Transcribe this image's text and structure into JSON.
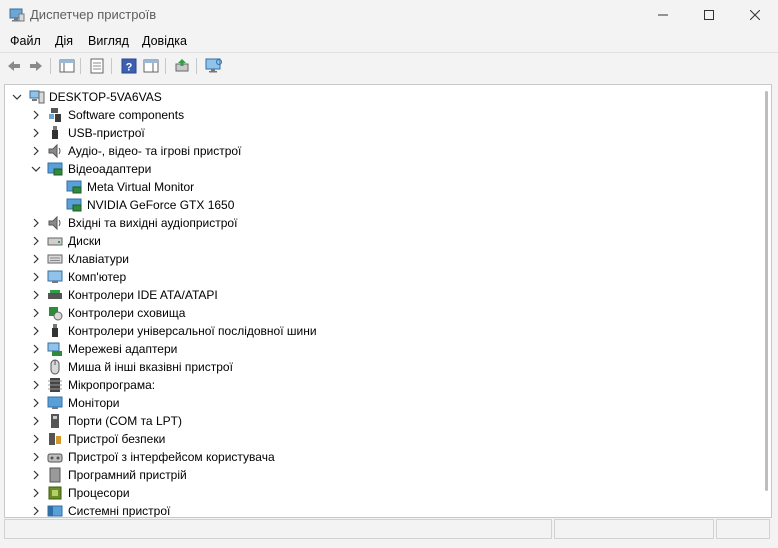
{
  "window": {
    "title": "Диспетчер пристроїв"
  },
  "menu": [
    "Файл",
    "Дія",
    "Вигляд",
    "Довідка"
  ],
  "toolbar": [
    {
      "name": "back-button",
      "icon": "arrow-left-icon"
    },
    {
      "name": "forward-button",
      "icon": "arrow-right-icon"
    },
    {
      "name": "show-hide-console-tree-button",
      "icon": "console-tree-icon"
    },
    {
      "name": "properties-button",
      "icon": "properties-icon"
    },
    {
      "name": "help-button",
      "icon": "help-icon"
    },
    {
      "name": "action-pane-button",
      "icon": "action-pane-icon"
    },
    {
      "name": "update-driver-button",
      "icon": "update-driver-icon"
    },
    {
      "name": "scan-hardware-button",
      "icon": "monitor-scan-icon"
    }
  ],
  "tree": {
    "root": "DESKTOP-5VA6VAS",
    "items": [
      {
        "label": "Software components",
        "icon": "software-component-icon",
        "expanded": false
      },
      {
        "label": "USB-пристрої",
        "icon": "usb-icon",
        "expanded": false
      },
      {
        "label": "Аудіо-, відео- та ігрові пристрої",
        "icon": "speaker-icon",
        "expanded": false
      },
      {
        "label": "Відеоадаптери",
        "icon": "display-adapter-icon",
        "expanded": true,
        "children": [
          {
            "label": "Meta Virtual Monitor",
            "icon": "display-adapter-icon"
          },
          {
            "label": "NVIDIA GeForce GTX 1650",
            "icon": "display-adapter-icon"
          }
        ]
      },
      {
        "label": "Вхідні та вихідні аудіопристрої",
        "icon": "speaker-icon",
        "expanded": false
      },
      {
        "label": "Диски",
        "icon": "disk-icon",
        "expanded": false
      },
      {
        "label": "Клавіатури",
        "icon": "keyboard-icon",
        "expanded": false
      },
      {
        "label": "Комп'ютер",
        "icon": "computer-icon",
        "expanded": false
      },
      {
        "label": "Контролери IDE ATA/ATAPI",
        "icon": "ide-controller-icon",
        "expanded": false
      },
      {
        "label": "Контролери сховища",
        "icon": "storage-controller-icon",
        "expanded": false
      },
      {
        "label": "Контролери універсальної послідовної шини",
        "icon": "usb-icon",
        "expanded": false
      },
      {
        "label": "Мережеві адаптери",
        "icon": "network-adapter-icon",
        "expanded": false
      },
      {
        "label": "Миша й інші вказівні пристрої",
        "icon": "mouse-icon",
        "expanded": false
      },
      {
        "label": "Мікропрограма:",
        "icon": "firmware-icon",
        "expanded": false
      },
      {
        "label": "Монітори",
        "icon": "monitor-icon",
        "expanded": false
      },
      {
        "label": "Порти (COM та LPT)",
        "icon": "port-icon",
        "expanded": false
      },
      {
        "label": "Пристрої безпеки",
        "icon": "security-device-icon",
        "expanded": false
      },
      {
        "label": "Пристрої з інтерфейсом користувача",
        "icon": "hid-icon",
        "expanded": false
      },
      {
        "label": "Програмний пристрій",
        "icon": "software-device-icon",
        "expanded": false
      },
      {
        "label": "Процесори",
        "icon": "processor-icon",
        "expanded": false
      },
      {
        "label": "Системні пристрої",
        "icon": "system-device-icon",
        "expanded": false
      }
    ]
  },
  "status": [
    "",
    "",
    ""
  ]
}
